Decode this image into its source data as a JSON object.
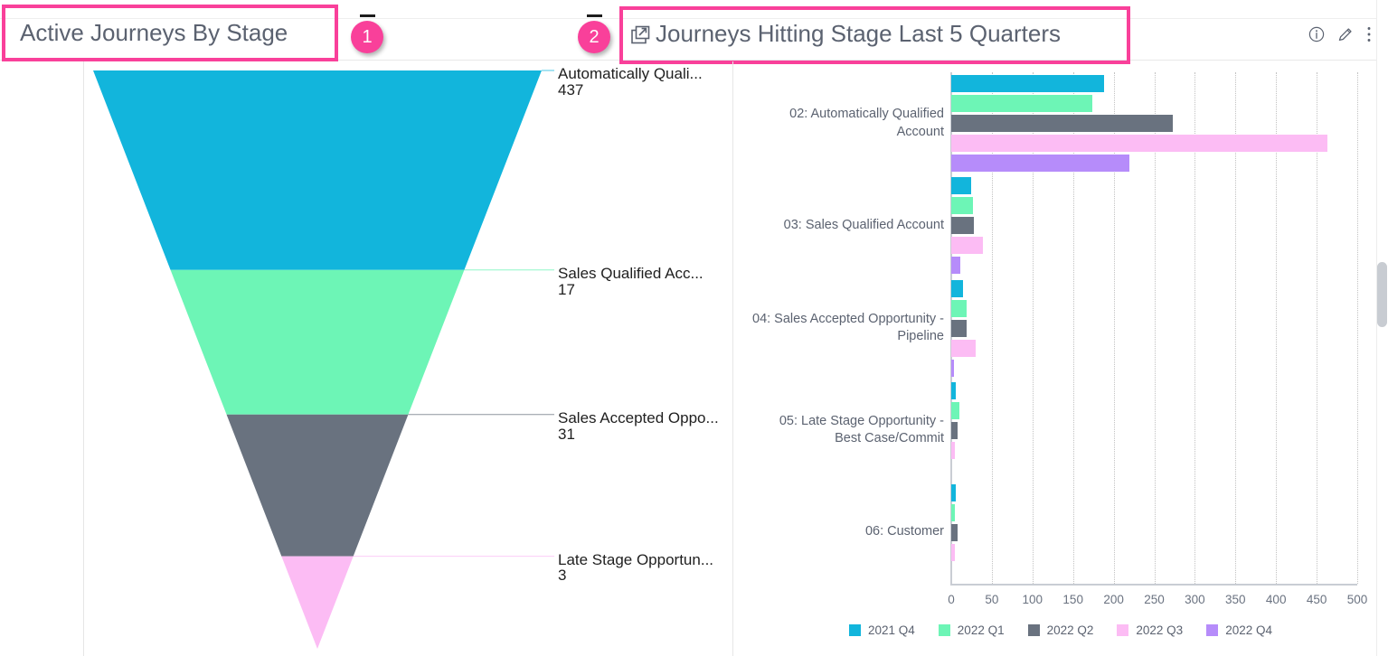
{
  "header": {
    "left_title": "Active Journeys By Stage",
    "right_title": "Journeys Hitting Stage Last 5 Quarters",
    "popout_icon": "open-in-new-window-icon",
    "icons": [
      {
        "name": "info-icon",
        "label": "Information"
      },
      {
        "name": "pencil-icon",
        "label": "Edit"
      },
      {
        "name": "more-vertical-icon",
        "label": "More options"
      }
    ]
  },
  "annotations": [
    {
      "badge": "1",
      "target": "Active Journeys By Stage"
    },
    {
      "badge": "2",
      "target": "Journeys Hitting Stage Last 5 Quarters"
    }
  ],
  "colors": {
    "annotation_pink": "#f9409a",
    "q2021_q4": "#12b5dc",
    "q2022_q1": "#6df5b6",
    "q2022_q2": "#69727f",
    "q2022_q3": "#fcbcf4",
    "q2022_q4": "#b68cfa",
    "text": "#5b6270"
  },
  "chart_data": [
    {
      "id": "active-journeys-funnel",
      "type": "funnel",
      "title": "Active Journeys By Stage",
      "stages": [
        {
          "label": "Automatically Quali...",
          "value": 437,
          "color": "#12b5dc"
        },
        {
          "label": "Sales Qualified Acc...",
          "value": 17,
          "color": "#6df5b6"
        },
        {
          "label": "Sales Accepted Oppo...",
          "value": 31,
          "color": "#69727f"
        },
        {
          "label": "Late Stage Opportun...",
          "value": 3,
          "color": "#fcbcf4"
        }
      ]
    },
    {
      "id": "journeys-hitting-stage",
      "type": "bar",
      "orientation": "horizontal",
      "title": "Journeys Hitting Stage Last 5 Quarters",
      "xlabel": "",
      "ylabel": "",
      "xlim": [
        0,
        500
      ],
      "xticks": [
        0,
        50,
        100,
        150,
        200,
        250,
        300,
        350,
        400,
        450,
        500
      ],
      "grid": true,
      "legend_position": "bottom",
      "categories": [
        "02: Automatically Qualified Account",
        "03: Sales Qualified Account",
        "04: Sales Accepted Opportunity - Pipeline",
        "05: Late Stage Opportunity - Best Case/Commit",
        "06: Customer"
      ],
      "series": [
        {
          "name": "2021 Q4",
          "color": "#12b5dc",
          "values": [
            188,
            24,
            14,
            6,
            6
          ]
        },
        {
          "name": "2022 Q1",
          "color": "#6df5b6",
          "values": [
            174,
            27,
            19,
            10,
            5
          ]
        },
        {
          "name": "2022 Q2",
          "color": "#69727f",
          "values": [
            273,
            28,
            19,
            8,
            8
          ]
        },
        {
          "name": "2022 Q3",
          "color": "#fcbcf4",
          "values": [
            463,
            39,
            30,
            5,
            4
          ]
        },
        {
          "name": "2022 Q4",
          "color": "#b68cfa",
          "values": [
            219,
            11,
            3,
            0,
            0
          ]
        }
      ]
    }
  ],
  "scrollbar": {
    "name": "vertical-scrollbar"
  }
}
